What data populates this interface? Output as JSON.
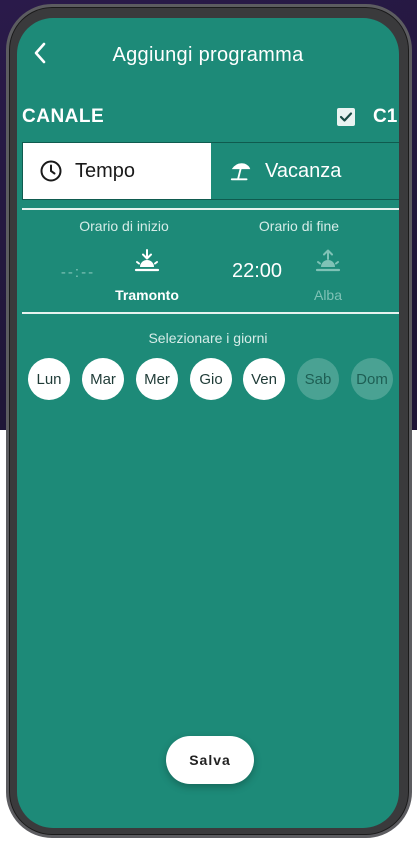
{
  "header": {
    "title": "Aggiungi programma",
    "back_icon": "chevron-left-icon"
  },
  "channel": {
    "label": "CANALE",
    "value": "C1",
    "checked": true
  },
  "tabs": [
    {
      "label": "Tempo",
      "icon": "clock-icon",
      "active": true
    },
    {
      "label": "Vacanza",
      "icon": "beach-umbrella-icon",
      "active": false
    }
  ],
  "schedule": {
    "start": {
      "label": "Orario di inizio",
      "time": "--:--",
      "mode_label": "Tramonto",
      "mode_icon": "sunset-icon",
      "mode_active": true
    },
    "end": {
      "label": "Orario di fine",
      "time": "22:00",
      "mode_label": "Alba",
      "mode_icon": "sunrise-icon",
      "mode_active": false
    }
  },
  "days": {
    "label": "Selezionare i giorni",
    "items": [
      {
        "label": "Lun",
        "selected": true
      },
      {
        "label": "Mar",
        "selected": true
      },
      {
        "label": "Mer",
        "selected": true
      },
      {
        "label": "Gio",
        "selected": true
      },
      {
        "label": "Ven",
        "selected": true
      },
      {
        "label": "Sab",
        "selected": false
      },
      {
        "label": "Dom",
        "selected": false
      }
    ]
  },
  "actions": {
    "save_label": "Salva"
  },
  "colors": {
    "screen_bg": "#1d8a78",
    "day_on": "#ffffff",
    "day_off": "#4aa293",
    "faded": "#7fc2b6"
  }
}
